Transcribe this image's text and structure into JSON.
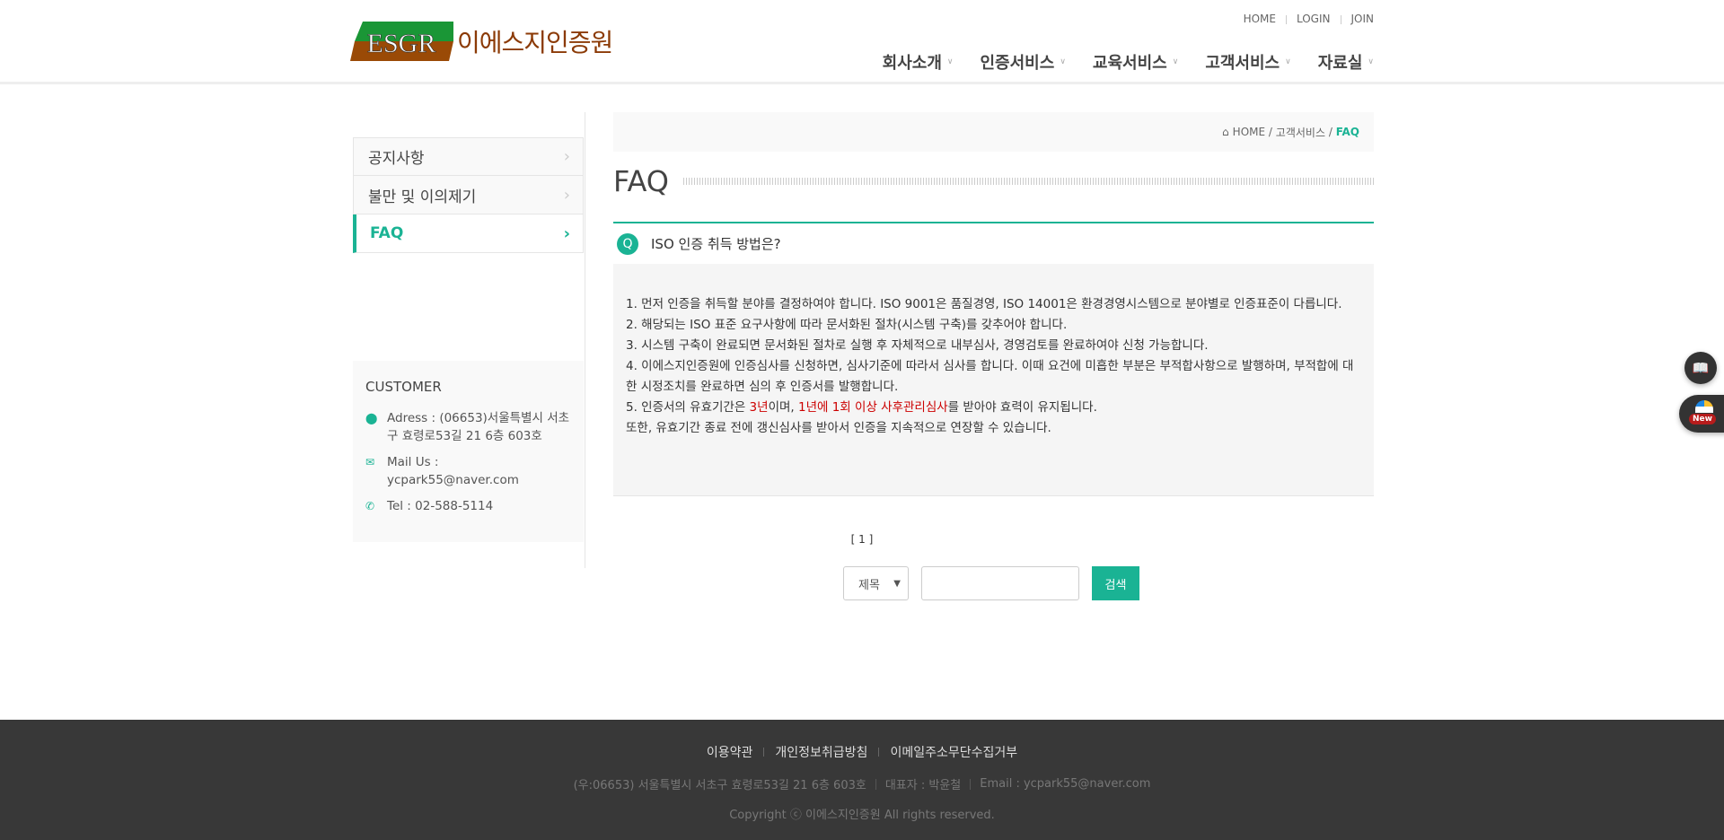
{
  "header": {
    "logo_mark": "ESGR",
    "logo_text": "이에스지인증원",
    "top_links": [
      "HOME",
      "LOGIN",
      "JOIN"
    ],
    "nav": [
      "회사소개",
      "인증서비스",
      "교육서비스",
      "고객서비스",
      "자료실"
    ]
  },
  "sidebar": {
    "items": [
      "공지사항",
      "불만 및 이의제기",
      "FAQ"
    ],
    "active": "FAQ"
  },
  "customer": {
    "title": "CUSTOMER",
    "address": "Adress : (06653)서울특별시 서초구 효령로53길 21 6층 603호",
    "mail": "Mail Us : ycpark55@naver.com",
    "tel": "Tel : 02-588-5114"
  },
  "breadcrumb": {
    "home": "HOME",
    "sep": "/",
    "section": "고객서비스",
    "current": "FAQ"
  },
  "page_title": "FAQ",
  "faq": {
    "badge": "Q",
    "question": "ISO 인증 취득 방법은?",
    "answer": {
      "line1": "1. 먼저 인증을 취득할 분야를 결정하여야 합니다. ISO 9001은 품질경영, ISO 14001은 환경경영시스템으로 분야별로 인증표준이 다릅니다.",
      "line2": "2. 해당되는 ISO 표준 요구사항에 따라 문서화된 절차(시스템 구축)를 갖추어야 합니다.",
      "line3": "3. 시스템 구축이 완료되면 문서화된 절차로 실행 후 자체적으로 내부심사, 경영검토를 완료하여야 신청 가능합니다.",
      "line4": "4. 이에스지인증원에 인증심사를 신청하면, 심사기준에 따라서 심사를 합니다. 이때 요건에 미흡한 부분은 부적합사항으로 발행하며, 부적합에 대한 시정조치를 완료하면 심의 후 인증서를 발행합니다.",
      "line5a": "5. 인증서의 유효기간은 ",
      "line5b": "3년",
      "line5c": "이며, ",
      "line5d": "1년에 1회 이상 사후관리심사",
      "line5e": "를 받아야 효력이 유지됩니다.",
      "line6": "또한, 유효기간 종료 전에 갱신심사를 받아서 인증을 지속적으로 연장할 수 있습니다."
    }
  },
  "pagination": "[ 1 ]",
  "search": {
    "field_selected": "제목",
    "query": "",
    "button": "검색"
  },
  "footer": {
    "links": [
      "이용약관",
      "개인정보취급방침",
      "이메일주소무단수집거부"
    ],
    "address": "(우:06653) 서울특별시 서초구 효령로53길 21 6층 603호",
    "ceo": "대표자 : 박윤철",
    "email": "Email : ycpark55@naver.com",
    "copyright": "Copyright ⓒ 이에스지인증원 All rights reserved."
  },
  "floating": {
    "new_badge": "New"
  },
  "colors": {
    "accent": "#1ab394",
    "footer_bg": "#383838",
    "highlight": "#cc0000"
  }
}
